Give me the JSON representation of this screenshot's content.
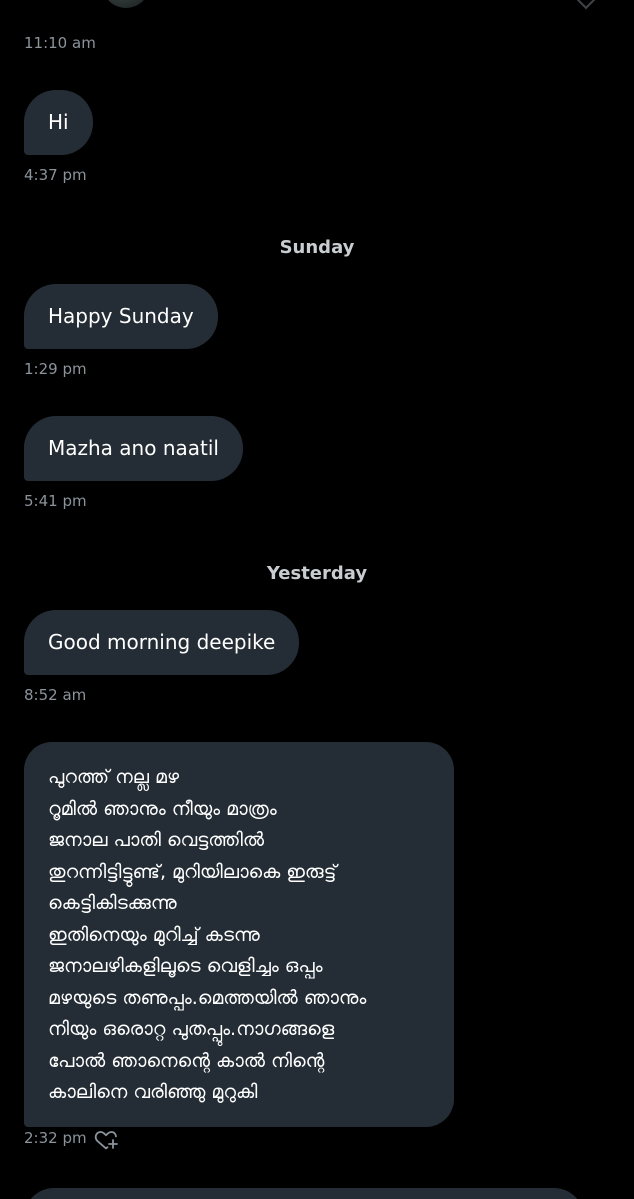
{
  "messages": [
    {
      "type": "time",
      "text": "11:10 am"
    },
    {
      "type": "bubble",
      "text": "Hi",
      "time": "4:37 pm"
    },
    {
      "type": "separator",
      "text": "Sunday"
    },
    {
      "type": "bubble",
      "text": "Happy Sunday",
      "time": "1:29 pm"
    },
    {
      "type": "bubble",
      "text": "Mazha ano naatil",
      "time": "5:41 pm"
    },
    {
      "type": "separator",
      "text": "Yesterday"
    },
    {
      "type": "bubble",
      "text": "Good morning deepike",
      "time": "8:52 am"
    },
    {
      "type": "bubble",
      "lines": [
        "പുറത്ത് നല്ല മഴ",
        "റൂമിൽ ഞാനും നീയും മാത്രം",
        "ജനാല പാതി വെട്ടത്തിൽ",
        "തുറന്നിട്ടിട്ടുണ്ട്, മുറിയിലാകെ ഇരുട്ട്",
        "കെട്ടികിടക്കുന്നു",
        "ഇതിനെയും മുറിച്ച് കടന്നു",
        "ജനാലഴികളിലൂടെ വെളിച്ചം ഒപ്പം",
        "മഴയുടെ തണുപ്പം.മെത്തയിൽ ഞാനും",
        "നിയും ഒരൊറ്റ പുതപ്പും.നാഗങ്ങളെ",
        "പോൽ ഞാനെന്റെ കാൽ നിന്റെ",
        "കാലിനെ വരിഞ്ഞു മുറുകി"
      ],
      "time": "2:32 pm",
      "reaction_icon": "heart-plus-icon"
    }
  ],
  "colors": {
    "background": "#000000",
    "bubble": "#242d35",
    "timestamp": "#8b939b",
    "separator": "#c8cdd2"
  }
}
